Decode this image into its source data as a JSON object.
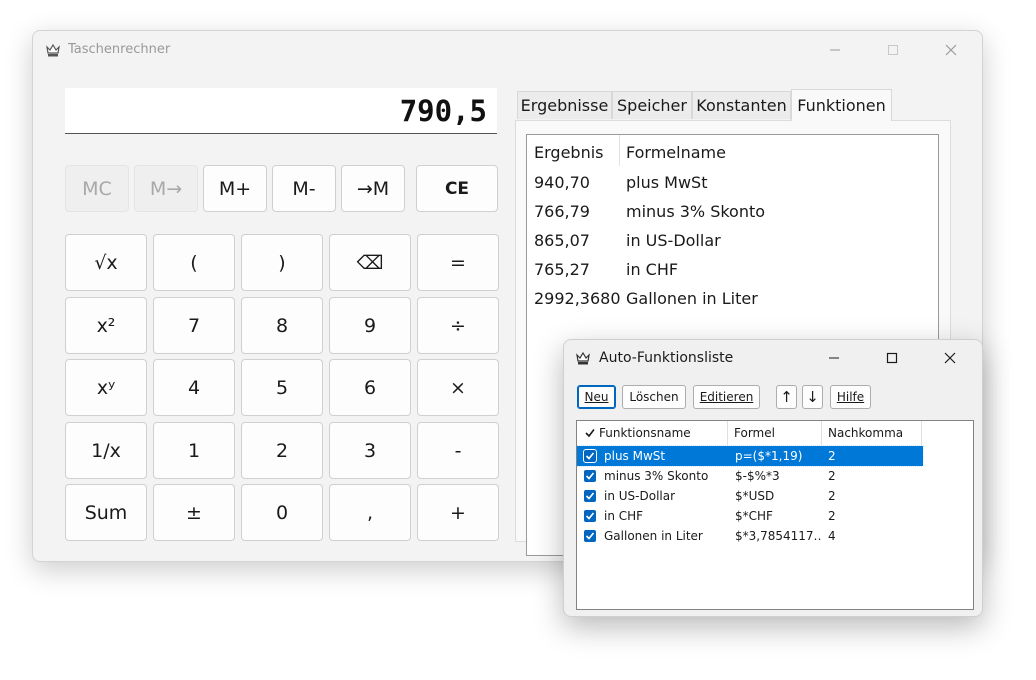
{
  "main_window": {
    "title": "Taschenrechner",
    "display_value": "790,5",
    "memory_buttons": [
      "MC",
      "M→",
      "M+",
      "M-",
      "→M",
      "CE"
    ],
    "keypad": [
      [
        "√x",
        "(",
        ")",
        "⌫",
        "="
      ],
      [
        "x²",
        "7",
        "8",
        "9",
        "÷"
      ],
      [
        "xʸ",
        "4",
        "5",
        "6",
        "×"
      ],
      [
        "1/x",
        "1",
        "2",
        "3",
        "-"
      ],
      [
        "Sum",
        "±",
        "0",
        ",",
        "+"
      ]
    ],
    "tabs": [
      "Ergebnisse",
      "Speicher",
      "Konstanten",
      "Funktionen"
    ],
    "active_tab": "Funktionen",
    "results": {
      "columns": [
        "Ergebnis",
        "Formelname"
      ],
      "rows": [
        [
          "940,70",
          "plus MwSt"
        ],
        [
          "766,79",
          "minus 3% Skonto"
        ],
        [
          "865,07",
          "in US-Dollar"
        ],
        [
          "765,27",
          "in CHF"
        ],
        [
          "2992,3680",
          "Gallonen in Liter"
        ]
      ]
    }
  },
  "dialog": {
    "title": "Auto-Funktionsliste",
    "buttons": {
      "new": "Neu",
      "delete": "Löschen",
      "edit": "Editieren",
      "up": "↑",
      "down": "↓",
      "help": "Hilfe"
    },
    "columns": [
      "Funktionsname",
      "Formel",
      "Nachkomma"
    ],
    "rows": [
      {
        "name": "plus MwSt",
        "formula": "p=($*1,19)",
        "decimals": "2",
        "checked": true,
        "selected": true
      },
      {
        "name": "minus 3% Skonto",
        "formula": "$-$%*3",
        "decimals": "2",
        "checked": true,
        "selected": false
      },
      {
        "name": "in US-Dollar",
        "formula": "$*USD",
        "decimals": "2",
        "checked": true,
        "selected": false
      },
      {
        "name": "in CHF",
        "formula": "$*CHF",
        "decimals": "2",
        "checked": true,
        "selected": false
      },
      {
        "name": "Gallonen in Liter",
        "formula": "$*3,7854117…",
        "decimals": "4",
        "checked": true,
        "selected": false
      }
    ]
  },
  "colors": {
    "accent": "#0067c0",
    "selection": "#0078d7"
  },
  "icons": {
    "app": "calculator-crown-icon",
    "minimize": "minimize-icon",
    "maximize": "maximize-icon",
    "close": "close-icon",
    "check": "checkmark-icon"
  }
}
